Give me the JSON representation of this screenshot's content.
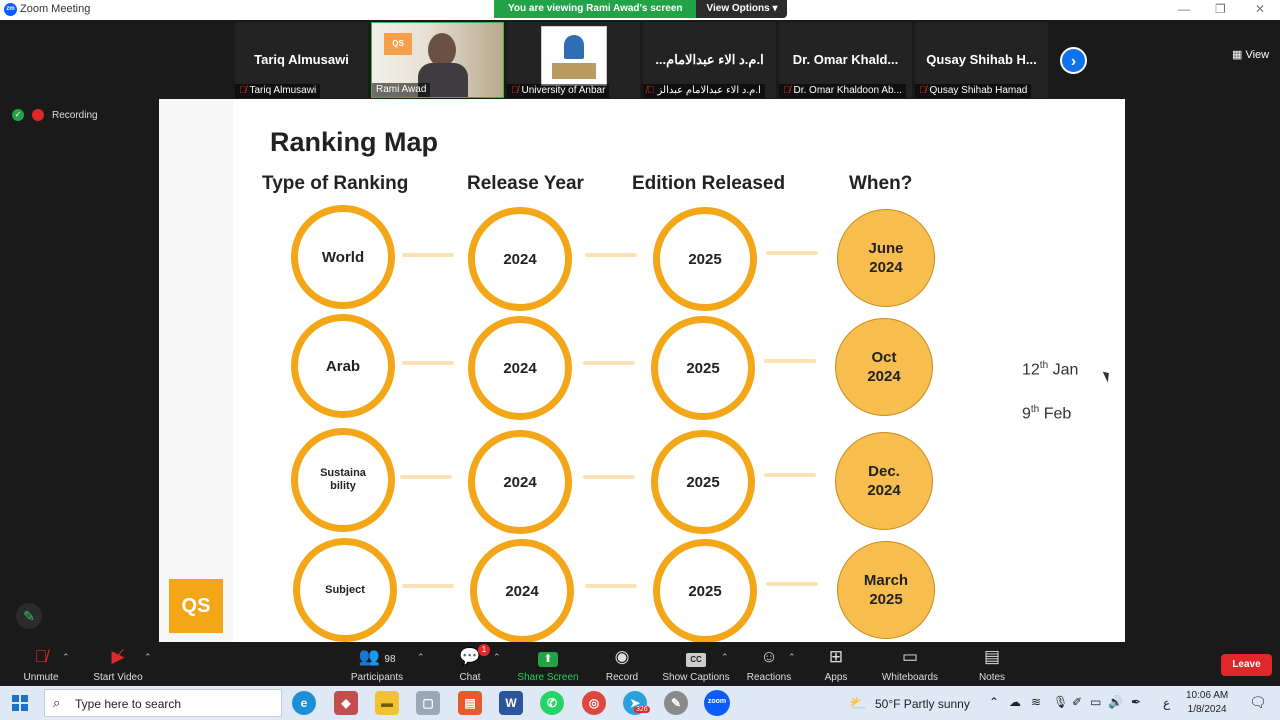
{
  "window": {
    "title": "Zoom Meeting",
    "app_icon": "zm"
  },
  "share_banner": {
    "viewing_text": "You are viewing Rami Awad's screen",
    "view_options": "View Options"
  },
  "view_button": "View",
  "participants_strip": [
    {
      "big_name": "Tariq Almusawi",
      "label": "Tariq Almusawi",
      "muted": true
    },
    {
      "big_name": "",
      "label": "Rami Awad",
      "muted": false,
      "video": true
    },
    {
      "big_name": "",
      "label": "University of Anbar",
      "muted": true,
      "logo": true
    },
    {
      "big_name": "ا.م.د الاء عبدالامام...",
      "label": "ا.م.د الاء عبدالامام عبدالز",
      "muted": true
    },
    {
      "big_name": "Dr. Omar Khald...",
      "label": "Dr. Omar Khaldoon Ab...",
      "muted": true
    },
    {
      "big_name": "Qusay Shihab H...",
      "label": "Qusay Shihab Hamad",
      "muted": true
    }
  ],
  "recording": {
    "label": "Recording"
  },
  "slide": {
    "title": "Ranking Map",
    "headers": [
      "Type of Ranking",
      "Release Year",
      "Edition Released",
      "When?"
    ],
    "rows": [
      {
        "type": "World",
        "release": "2024",
        "edition": "2025",
        "when_line1": "June",
        "when_line2": "2024"
      },
      {
        "type": "Arab",
        "release": "2024",
        "edition": "2025",
        "when_line1": "Oct",
        "when_line2": "2024"
      },
      {
        "type_line1": "Sustaina",
        "type_line2": "bility",
        "release": "2024",
        "edition": "2025",
        "when_line1": "Dec.",
        "when_line2": "2024"
      },
      {
        "type": "Subject",
        "release": "2024",
        "edition": "2025",
        "when_line1": "March",
        "when_line2": "2025"
      }
    ],
    "notes": [
      {
        "num": "12",
        "sup": "th",
        "text": "Jan"
      },
      {
        "num": "9",
        "sup": "th",
        "text": "Feb"
      }
    ],
    "logo_text": "QS"
  },
  "controls": {
    "unmute": "Unmute",
    "start_video": "Start Video",
    "participants": "Participants",
    "participants_count": "98",
    "chat": "Chat",
    "chat_badge": "1",
    "share_screen": "Share Screen",
    "record": "Record",
    "show_captions": "Show Captions",
    "reactions": "Reactions",
    "apps": "Apps",
    "whiteboards": "Whiteboards",
    "notes": "Notes",
    "leave": "Leave"
  },
  "taskbar": {
    "search_placeholder": "Type here to search",
    "weather": "50°F  Partly sunny",
    "time": "10:06 AM",
    "date": "1/8/2024",
    "lang": "ع",
    "mail_badge": "326"
  },
  "colors": {
    "ring": "#f3a618",
    "filled": "#f7bd4f",
    "banner_green": "#23a347",
    "leave_red": "#e02828",
    "zoom_blue": "#0e72ed"
  }
}
